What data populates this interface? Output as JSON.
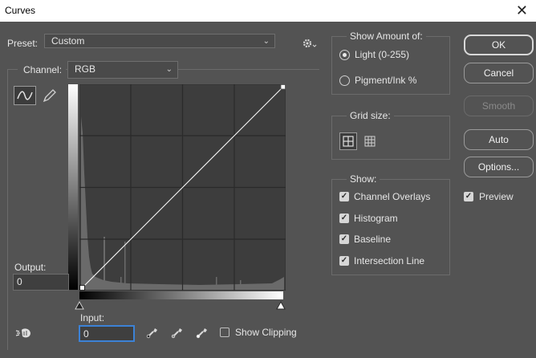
{
  "window": {
    "title": "Curves",
    "close_glyph": "✕"
  },
  "preset": {
    "label": "Preset:",
    "value": "Custom"
  },
  "channel": {
    "label": "Channel:",
    "value": "RGB"
  },
  "output": {
    "label": "Output:",
    "value": "0"
  },
  "input": {
    "label": "Input:",
    "value": "0"
  },
  "show_clipping": {
    "label": "Show Clipping",
    "checked": false
  },
  "show_amount": {
    "title": "Show Amount of:",
    "options": [
      {
        "label": "Light  (0-255)",
        "selected": true
      },
      {
        "label": "Pigment/Ink %",
        "selected": false
      }
    ]
  },
  "grid_size": {
    "title": "Grid size:"
  },
  "show": {
    "title": "Show:",
    "options": [
      {
        "label": "Channel Overlays",
        "checked": true
      },
      {
        "label": "Histogram",
        "checked": true
      },
      {
        "label": "Baseline",
        "checked": true
      },
      {
        "label": "Intersection Line",
        "checked": true
      }
    ]
  },
  "buttons": {
    "ok": "OK",
    "cancel": "Cancel",
    "smooth": "Smooth",
    "auto": "Auto",
    "options": "Options..."
  },
  "preview": {
    "label": "Preview",
    "checked": true
  },
  "icons": [
    "gear-icon",
    "curve-tool-icon",
    "pencil-icon",
    "targeted-adjustment-icon",
    "black-eyedropper-icon",
    "gray-eyedropper-icon",
    "white-eyedropper-icon",
    "grid-4-icon",
    "grid-10-icon",
    "checkmark-icon"
  ],
  "colors": {
    "background": "#535353",
    "graph_bg": "#3d3d3d",
    "gridline": "#2a2a2a",
    "histogram": "#6a6a6a",
    "curve": "#ffffff"
  }
}
